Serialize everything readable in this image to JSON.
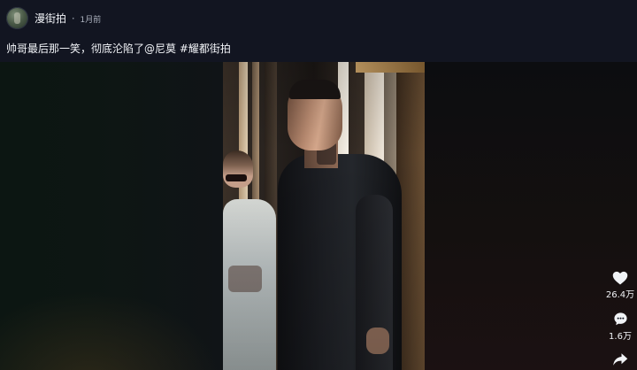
{
  "post": {
    "author": "漫街拍",
    "separator": "·",
    "time": "1月前",
    "caption": "帅哥最后那一笑，彻底沦陷了@尼莫 #耀都街拍"
  },
  "actions": {
    "like": {
      "icon": "heart-icon",
      "count": "26.4万"
    },
    "comment": {
      "icon": "comment-icon",
      "count": "1.6万"
    },
    "share": {
      "icon": "share-icon"
    }
  },
  "colors": {
    "background": "#121521",
    "text": "#f2f4f8",
    "muted": "#aeb4c0"
  }
}
